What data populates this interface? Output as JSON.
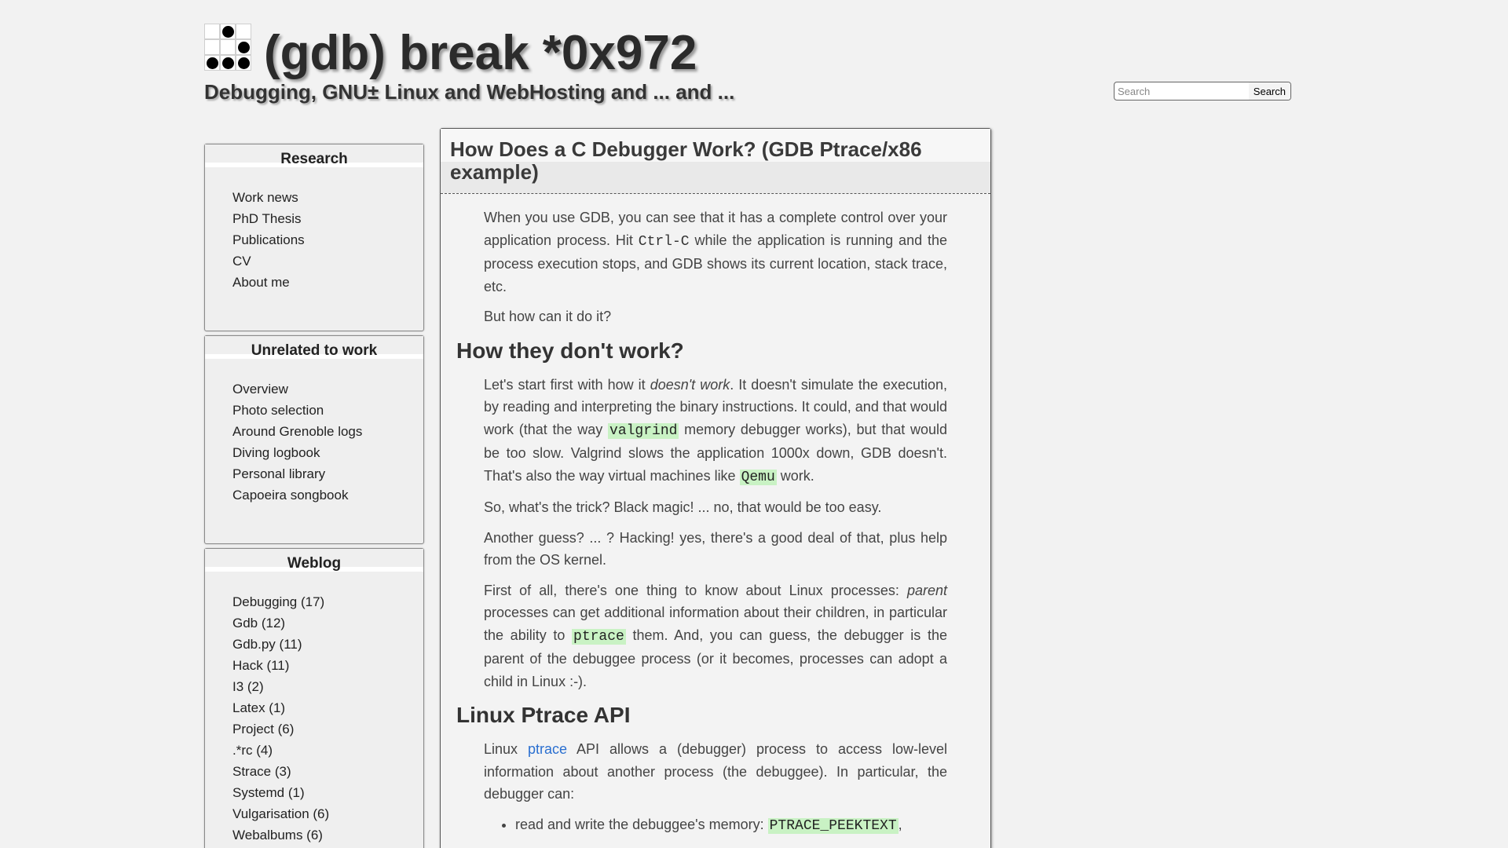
{
  "header": {
    "title": "(gdb) break *0x972",
    "subtitle": "Debugging, GNU± Linux and WebHosting and ... and ...",
    "logo_cells": [
      0,
      1,
      0,
      0,
      0,
      1,
      1,
      1,
      1
    ]
  },
  "search": {
    "placeholder": "Search",
    "value": "",
    "button_label": "Search"
  },
  "sidebar": {
    "research": {
      "title": "Research",
      "items": [
        "Work news",
        "PhD Thesis",
        "Publications",
        "CV",
        "About me"
      ]
    },
    "unrelated": {
      "title": "Unrelated to work",
      "items": [
        "Overview",
        "Photo selection",
        "Around Grenoble logs",
        "Diving logbook",
        "Personal library",
        "Capoeira songbook"
      ]
    },
    "weblog": {
      "title": "Weblog",
      "items": [
        "Debugging (17)",
        "Gdb (12)",
        "Gdb.py (11)",
        "Hack (11)",
        "I3 (2)",
        "Latex (1)",
        "Project (6)",
        ".*rc (4)",
        "Strace (3)",
        "Systemd (1)",
        "Vulgarisation (6)",
        "Webalbums (6)"
      ]
    }
  },
  "article": {
    "title": "How Does a C Debugger Work? (GDB Ptrace/x86 example)",
    "p1": {
      "a": "When you use GDB, you can see that it has a complete control over your application process. Hit ",
      "code": "Ctrl-C",
      "b": " while the application is running and the process execution stops, and GDB shows its current location, stack trace, etc."
    },
    "p2": "But how can it do it?",
    "h2_1": "How they don't work?",
    "p3": {
      "a": "Let's start first with how it ",
      "em": "doesn't work",
      "b": ". It doesn't simulate the execution, by reading and interpreting the binary instructions. It could, and that would work (that the way ",
      "code1": "valgrind",
      "c": " memory debugger works), but that would be too slow. Valgrind slows the application 1000x down, GDB doesn't. That's also the way virtual machines like ",
      "code2": "Qemu",
      "d": " work."
    },
    "p4": "So, what's the trick? Black magic! ... no, that would be too easy.",
    "p5": "Another guess? ... ? Hacking! yes, there's a good deal of that, plus help from the OS kernel.",
    "p6": {
      "a": "First of all, there's one thing to know about Linux processes: ",
      "em": "parent",
      "b": " processes can get additional information about their children, in particular the ability to ",
      "code": "ptrace",
      "c": " them. And, you can guess, the debugger is the parent of the debuggee process (or it becomes, processes can adopt a child in Linux :-)."
    },
    "h2_2": "Linux Ptrace API",
    "p7": {
      "a": "Linux ",
      "link": "ptrace",
      "b": " API allows a (debugger) process to access low-level information about another process (the debuggee). In particular, the debugger can:"
    },
    "li1": {
      "a": "read and write the debuggee's memory: ",
      "code": "PTRACE_PEEKTEXT",
      "b": ","
    }
  }
}
